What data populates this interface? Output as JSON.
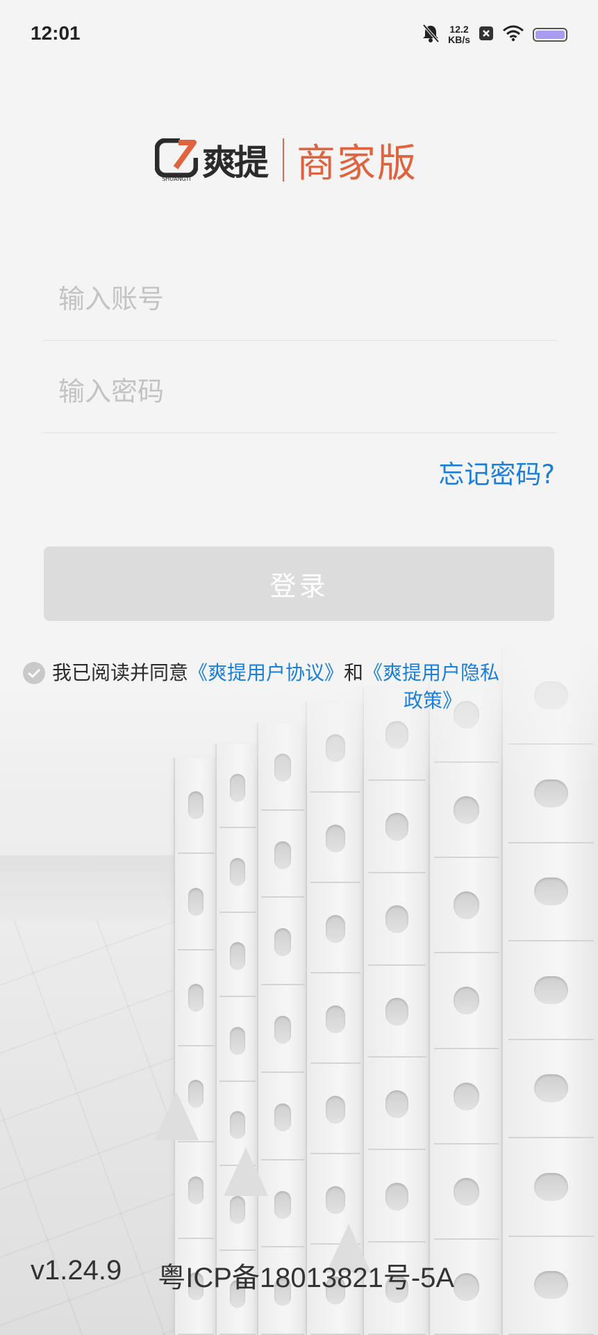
{
  "status_bar": {
    "time": "12:01",
    "net_speed_value": "12.2",
    "net_speed_unit": "KB/s",
    "icons": [
      "bell-muted-icon",
      "close-box-icon",
      "wifi-icon",
      "battery-icon"
    ],
    "battery_color": "#a99bf0"
  },
  "logo": {
    "brand": "爽提",
    "mark_text": "SHUANGTI",
    "edition": "商家版",
    "brand_color": "#e0633f"
  },
  "form": {
    "account_placeholder": "输入账号",
    "account_value": "",
    "password_placeholder": "输入密码",
    "password_value": "",
    "forgot_password": "忘记密码?",
    "login_label": "登录",
    "link_color": "#1c7fd6"
  },
  "agreement": {
    "checked": false,
    "prefix": "我已阅读并同意",
    "user_agreement": "《爽提用户协议》",
    "conjunction": "和",
    "privacy_part1": "《爽提用户隐私",
    "privacy_part2": "政策》"
  },
  "footer": {
    "version": "v1.24.9",
    "icp": "粤ICP备18013821号-5A"
  }
}
